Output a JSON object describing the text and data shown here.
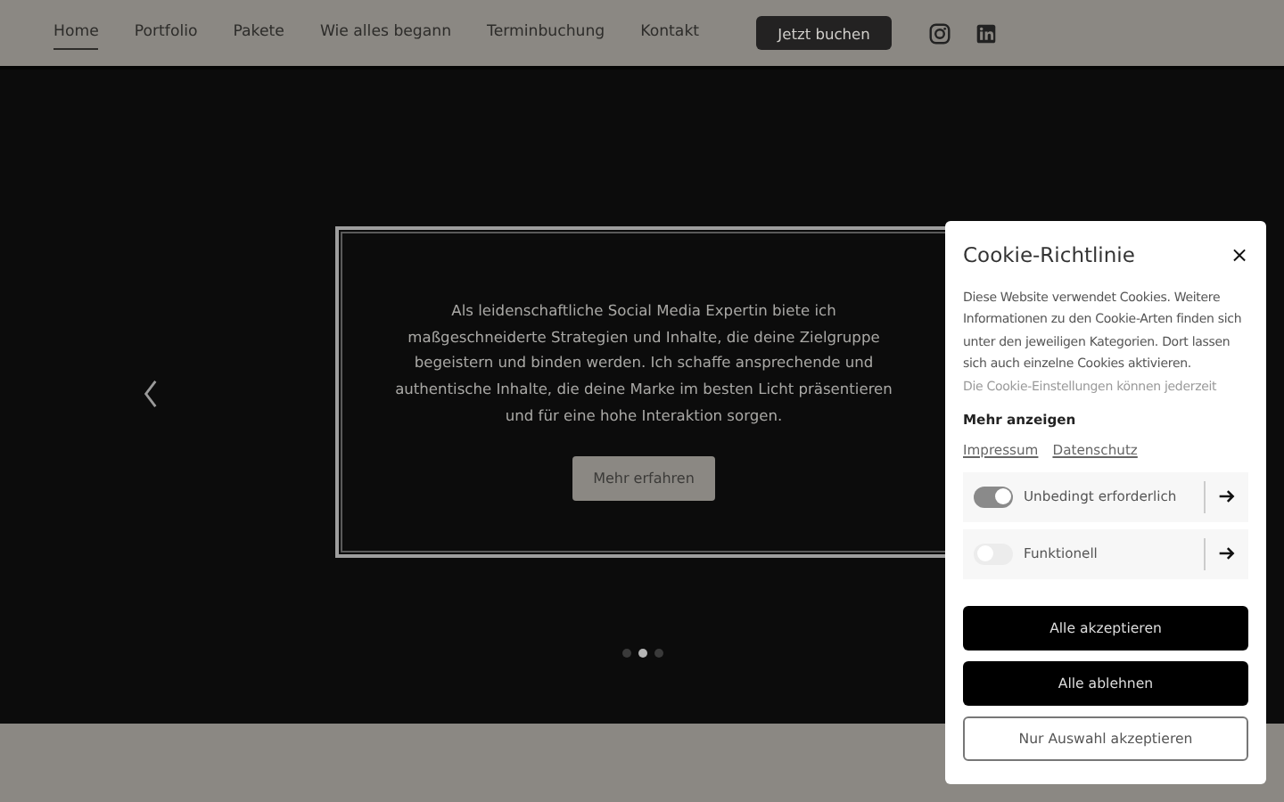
{
  "nav": {
    "items": [
      {
        "label": "Home",
        "selected": true
      },
      {
        "label": "Portfolio",
        "selected": false
      },
      {
        "label": "Pakete",
        "selected": false
      },
      {
        "label": "Wie alles begann",
        "selected": false
      },
      {
        "label": "Terminbuchung",
        "selected": false
      },
      {
        "label": "Kontakt",
        "selected": false
      }
    ],
    "cta": "Jetzt buchen"
  },
  "hero": {
    "text": "Als leidenschaftliche Social Media Expertin biete ich maßgeschneiderte Strategien und Inhalte, die deine Zielgruppe begeistern und binden werden. Ich schaffe ansprechende und authentische Inhalte, die deine Marke im besten Licht präsentieren und für eine hohe Interaktion sorgen.",
    "button": "Mehr erfahren",
    "dots": [
      {
        "selected": false
      },
      {
        "selected": true
      },
      {
        "selected": false
      }
    ]
  },
  "cookie": {
    "title": "Cookie-Richtlinie",
    "close": "×",
    "description": "Diese Website verwendet Cookies. Weitere Informationen zu den Cookie-Arten finden sich unter den jeweiligen Kategorien. Dort lassen sich auch einzelne Cookies aktivieren.",
    "description_faded": "Die Cookie-Einstellungen können jederzeit",
    "more": "Mehr anzeigen",
    "links": [
      "Impressum",
      "Datenschutz"
    ],
    "categories": [
      {
        "label": "Unbedingt erforderlich",
        "on": true
      },
      {
        "label": "Funktionell",
        "on": false
      }
    ],
    "buttons": [
      {
        "label": "Alle akzeptieren",
        "kind": "primary"
      },
      {
        "label": "Alle ablehnen",
        "kind": "primary"
      },
      {
        "label": "Nur Auswahl akzeptieren",
        "kind": "outline"
      }
    ]
  }
}
